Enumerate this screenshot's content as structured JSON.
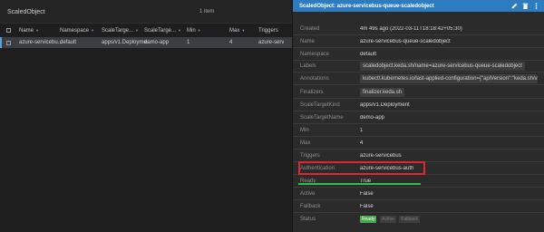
{
  "list": {
    "title": "ScaledObject",
    "count": "1 item",
    "columns": [
      "Name",
      "Namespace",
      "ScaleTarge...",
      "ScaleTarge...",
      "Min",
      "Max",
      "Triggers"
    ],
    "row": [
      "azure-servicebu...",
      "default",
      "apps/v1.Deployme...",
      "demo-app",
      "1",
      "4",
      "azure-serv"
    ]
  },
  "drawer": {
    "title": "ScaledObject: azure-servicebus-queue-scaledobject",
    "fields": [
      {
        "label": "Created",
        "value": "4m 49s ago (2022-03-11T18:18:42+05:30)"
      },
      {
        "label": "Name",
        "value": "azure-servicebus-queue-scaledobject"
      },
      {
        "label": "Namespace",
        "value": "default"
      },
      {
        "label": "Labels",
        "value": "scaledobject.keda.sh/name=azure-servicebus-queue-scaledobject",
        "chip": true
      },
      {
        "label": "Annotations",
        "value": "kubectl.kubernetes.io/last-applied-configuration={\"apiVersion\":\"keda.sh/v...",
        "chip": true
      },
      {
        "label": "Finalizers",
        "value": "finalizer.keda.sh",
        "chip": true
      },
      {
        "label": "ScaleTargetKind",
        "value": "apps/v1.Deployment"
      },
      {
        "label": "ScaleTargetName",
        "value": "demo-app"
      },
      {
        "label": "Min",
        "value": "1"
      },
      {
        "label": "Max",
        "value": "4"
      },
      {
        "label": "Triggers",
        "value": "azure-servicebus"
      },
      {
        "label": "Authentication",
        "value": "azure-servicebus-auth"
      },
      {
        "label": "Ready",
        "value": "True"
      },
      {
        "label": "Active",
        "value": "False"
      },
      {
        "label": "Fallback",
        "value": "False"
      },
      {
        "label": "Status",
        "value": ""
      }
    ],
    "status_badges": [
      "Ready",
      "Active",
      "Fallback"
    ]
  },
  "colors": {
    "header_accent": "#2e7cc0",
    "highlight_border": "#e0262e",
    "ready_underline": "#2fbf4c",
    "ready_badge": "#46a84a"
  }
}
